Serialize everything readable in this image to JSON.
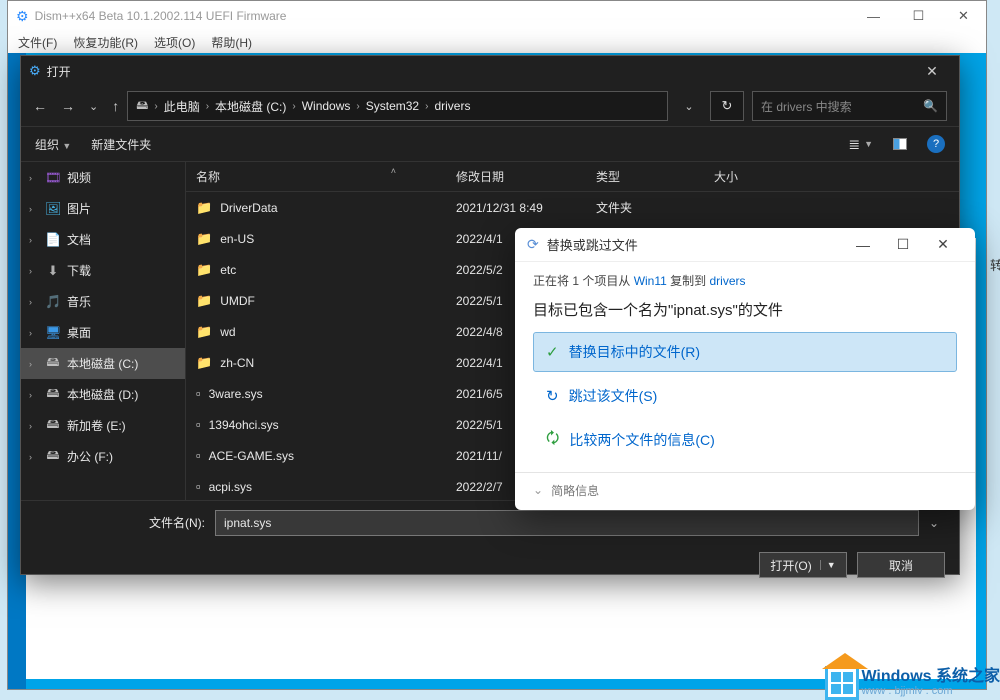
{
  "app": {
    "title": "Dism++x64 Beta 10.1.2002.114 UEFI Firmware",
    "menu": [
      "文件(F)",
      "恢复功能(R)",
      "选项(O)",
      "帮助(H)"
    ]
  },
  "dialog": {
    "title": "打开",
    "breadcrumb": [
      "此电脑",
      "本地磁盘 (C:)",
      "Windows",
      "System32",
      "drivers"
    ],
    "search_placeholder": "在 drivers 中搜索",
    "toolbar": {
      "organize": "组织",
      "newfolder": "新建文件夹"
    },
    "tree": [
      {
        "icon": "🎞",
        "label": "视频",
        "color": "#9a5bd6"
      },
      {
        "icon": "🖼",
        "label": "图片",
        "color": "#46b1e1"
      },
      {
        "icon": "📄",
        "label": "文档",
        "color": "#d6d6a8"
      },
      {
        "icon": "⬇",
        "label": "下载",
        "color": "#b0b0b0"
      },
      {
        "icon": "🎵",
        "label": "音乐",
        "color": "#e04a7a"
      },
      {
        "icon": "🖥",
        "label": "桌面",
        "color": "#3b99e8"
      },
      {
        "icon": "🖴",
        "label": "本地磁盘 (C:)",
        "selected": true,
        "color": "#bfbfbf"
      },
      {
        "icon": "🖴",
        "label": "本地磁盘 (D:)",
        "color": "#bfbfbf"
      },
      {
        "icon": "🖴",
        "label": "新加卷 (E:)",
        "color": "#bfbfbf"
      },
      {
        "icon": "🖴",
        "label": "办公 (F:)",
        "color": "#bfbfbf"
      }
    ],
    "columns": {
      "name": "名称",
      "date": "修改日期",
      "type": "类型",
      "size": "大小"
    },
    "rows": [
      {
        "t": "folder",
        "name": "DriverData",
        "date": "2021/12/31 8:49",
        "type": "文件夹"
      },
      {
        "t": "folder",
        "name": "en-US",
        "date": "2022/4/1"
      },
      {
        "t": "folder",
        "name": "etc",
        "date": "2022/5/2"
      },
      {
        "t": "folder",
        "name": "UMDF",
        "date": "2022/5/1"
      },
      {
        "t": "folder",
        "name": "wd",
        "date": "2022/4/8"
      },
      {
        "t": "folder",
        "name": "zh-CN",
        "date": "2022/4/1"
      },
      {
        "t": "file",
        "name": "3ware.sys",
        "date": "2021/6/5"
      },
      {
        "t": "file",
        "name": "1394ohci.sys",
        "date": "2022/5/1"
      },
      {
        "t": "file",
        "name": "ACE-GAME.sys",
        "date": "2021/11/"
      },
      {
        "t": "file",
        "name": "acpi.sys",
        "date": "2022/2/7"
      }
    ],
    "filename_label": "文件名(N):",
    "filename_value": "ipnat.sys",
    "open_btn": "打开(O)",
    "cancel_btn": "取消"
  },
  "copy": {
    "title": "替换或跳过文件",
    "info_pre": "正在将 1 个项目从 ",
    "info_src": "Win11",
    "info_mid": " 复制到 ",
    "info_dst": "drivers",
    "message": "目标已包含一个名为\"ipnat.sys\"的文件",
    "opt_replace": "替换目标中的文件(R)",
    "opt_skip": "跳过该文件(S)",
    "opt_compare": "比较两个文件的信息(C)",
    "footer": "简略信息"
  },
  "watermark": {
    "big": "Windows 系统之家",
    "small": "www . bjjmlv . com"
  },
  "stray": "转"
}
